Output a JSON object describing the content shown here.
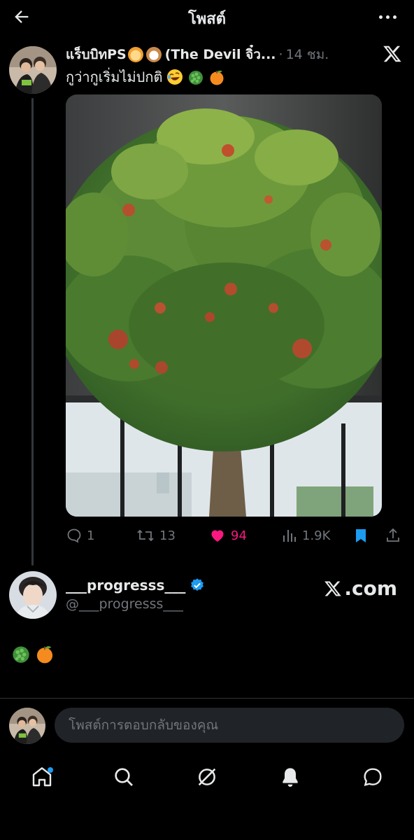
{
  "header": {
    "title": "โพสต์",
    "back_icon": "arrow-left-icon",
    "more_icon": "more-horizontal-icon"
  },
  "post": {
    "author_name_start": "แร็บบิทPS",
    "author_name_end": "(The Devil จิ๋ว...",
    "author_emojis": [
      "tiger-face-emoji",
      "dog-face-emoji"
    ],
    "dot": "·",
    "time": "14 ชม.",
    "text": "กูว่ากูเริ่มไม่ปกติ",
    "text_emojis": [
      "rolling-laughing-emoji",
      "custard-apple-emoji",
      "tangerine-emoji"
    ]
  },
  "actions": {
    "replies": "1",
    "reposts": "13",
    "likes": "94",
    "views": "1.9K",
    "like_color": "#f91880",
    "bookmark_color": "#1d9bf0"
  },
  "quoted": {
    "name": "___progresss___",
    "handle": "@___progresss___",
    "verified_color": "#1d9bf0",
    "brand": ".com",
    "emojis": [
      "custard-apple-emoji",
      "tangerine-emoji"
    ]
  },
  "reply": {
    "placeholder": "โพสต์การตอบกลับของคุณ"
  },
  "nav": {
    "items": [
      "home-icon",
      "search-icon",
      "grok-icon",
      "notifications-icon",
      "messages-icon"
    ],
    "notification_dot_color": "#1d9bf0"
  }
}
